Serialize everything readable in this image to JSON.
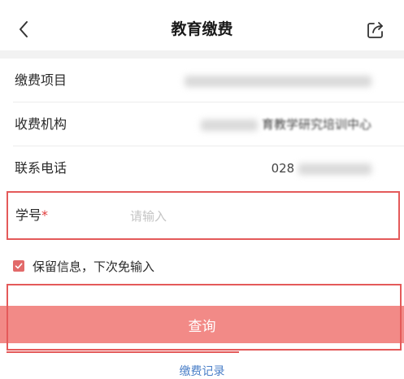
{
  "header": {
    "title": "教育缴费",
    "back_icon": "chevron-left-icon",
    "share_icon": "share-icon"
  },
  "form": {
    "rows": [
      {
        "label": "缴费项目",
        "value": ""
      },
      {
        "label": "收费机构",
        "value": "育教学研究培训中心"
      },
      {
        "label": "联系电话",
        "value": "028"
      }
    ],
    "student_id": {
      "label": "学号",
      "required_mark": "*",
      "placeholder": "请输入",
      "value": ""
    },
    "remember": {
      "checked": true,
      "label": "保留信息，下次免输入"
    }
  },
  "actions": {
    "query_label": "查询",
    "records_link": "缴费记录"
  },
  "colors": {
    "accent": "#e45a5a",
    "button": "#f28a87",
    "link": "#4a7fc8"
  }
}
